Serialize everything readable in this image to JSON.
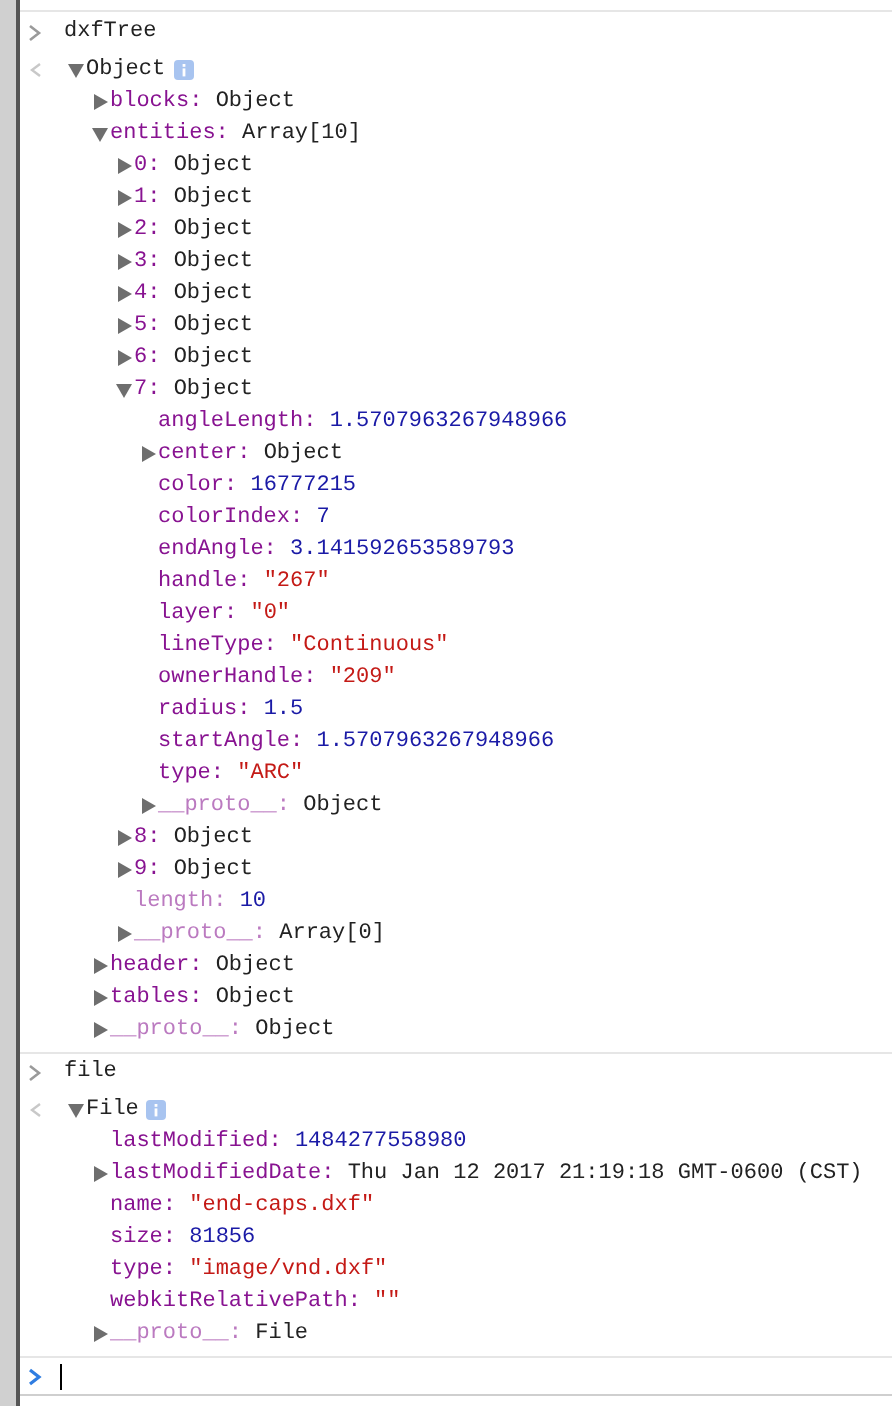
{
  "entries": [
    {
      "kind": "command",
      "text": "dxfTree"
    },
    {
      "kind": "result",
      "tree": {
        "value": "Object",
        "kind": "object",
        "expanded": true,
        "info": true,
        "children": [
          {
            "key": "blocks:",
            "value": "Object",
            "kind": "object",
            "dim": false,
            "expanded": false
          },
          {
            "key": "entities:",
            "value": "Array[10]",
            "kind": "object",
            "dim": false,
            "expanded": true,
            "children": [
              {
                "key": "0:",
                "value": "Object",
                "kind": "object",
                "dim": false,
                "expanded": false
              },
              {
                "key": "1:",
                "value": "Object",
                "kind": "object",
                "dim": false,
                "expanded": false
              },
              {
                "key": "2:",
                "value": "Object",
                "kind": "object",
                "dim": false,
                "expanded": false
              },
              {
                "key": "3:",
                "value": "Object",
                "kind": "object",
                "dim": false,
                "expanded": false
              },
              {
                "key": "4:",
                "value": "Object",
                "kind": "object",
                "dim": false,
                "expanded": false
              },
              {
                "key": "5:",
                "value": "Object",
                "kind": "object",
                "dim": false,
                "expanded": false
              },
              {
                "key": "6:",
                "value": "Object",
                "kind": "object",
                "dim": false,
                "expanded": false
              },
              {
                "key": "7:",
                "value": "Object",
                "kind": "object",
                "dim": false,
                "expanded": true,
                "children": [
                  {
                    "key": "angleLength:",
                    "value": "1.5707963267948966",
                    "kind": "number",
                    "dim": false
                  },
                  {
                    "key": "center:",
                    "value": "Object",
                    "kind": "object",
                    "dim": false,
                    "expanded": false
                  },
                  {
                    "key": "color:",
                    "value": "16777215",
                    "kind": "number",
                    "dim": false
                  },
                  {
                    "key": "colorIndex:",
                    "value": "7",
                    "kind": "number",
                    "dim": false
                  },
                  {
                    "key": "endAngle:",
                    "value": "3.141592653589793",
                    "kind": "number",
                    "dim": false
                  },
                  {
                    "key": "handle:",
                    "value": "\"267\"",
                    "kind": "string",
                    "dim": false
                  },
                  {
                    "key": "layer:",
                    "value": "\"0\"",
                    "kind": "string",
                    "dim": false
                  },
                  {
                    "key": "lineType:",
                    "value": "\"Continuous\"",
                    "kind": "string",
                    "dim": false
                  },
                  {
                    "key": "ownerHandle:",
                    "value": "\"209\"",
                    "kind": "string",
                    "dim": false
                  },
                  {
                    "key": "radius:",
                    "value": "1.5",
                    "kind": "number",
                    "dim": false
                  },
                  {
                    "key": "startAngle:",
                    "value": "1.5707963267948966",
                    "kind": "number",
                    "dim": false
                  },
                  {
                    "key": "type:",
                    "value": "\"ARC\"",
                    "kind": "string",
                    "dim": false
                  },
                  {
                    "key": "__proto__:",
                    "value": "Object",
                    "kind": "object",
                    "dim": true,
                    "expanded": false
                  }
                ]
              },
              {
                "key": "8:",
                "value": "Object",
                "kind": "object",
                "dim": false,
                "expanded": false
              },
              {
                "key": "9:",
                "value": "Object",
                "kind": "object",
                "dim": false,
                "expanded": false
              },
              {
                "key": "length:",
                "value": "10",
                "kind": "number",
                "dim": true
              },
              {
                "key": "__proto__:",
                "value": "Array[0]",
                "kind": "object",
                "dim": true,
                "expanded": false
              }
            ]
          },
          {
            "key": "header:",
            "value": "Object",
            "kind": "object",
            "dim": false,
            "expanded": false
          },
          {
            "key": "tables:",
            "value": "Object",
            "kind": "object",
            "dim": false,
            "expanded": false
          },
          {
            "key": "__proto__:",
            "value": "Object",
            "kind": "object",
            "dim": true,
            "expanded": false
          }
        ]
      }
    },
    {
      "kind": "command",
      "text": "file"
    },
    {
      "kind": "result",
      "tree": {
        "value": "File",
        "kind": "object",
        "expanded": true,
        "info": true,
        "children": [
          {
            "key": "lastModified:",
            "value": "1484277558980",
            "kind": "number",
            "dim": false
          },
          {
            "key": "lastModifiedDate:",
            "value": "Thu Jan 12 2017 21:19:18 GMT-0600 (CST)",
            "kind": "object",
            "dim": false,
            "expanded": false
          },
          {
            "key": "name:",
            "value": "\"end-caps.dxf\"",
            "kind": "string",
            "dim": false
          },
          {
            "key": "size:",
            "value": "81856",
            "kind": "number",
            "dim": false
          },
          {
            "key": "type:",
            "value": "\"image/vnd.dxf\"",
            "kind": "string",
            "dim": false
          },
          {
            "key": "webkitRelativePath:",
            "value": "\"\"",
            "kind": "string",
            "dim": false
          },
          {
            "key": "__proto__:",
            "value": "File",
            "kind": "object",
            "dim": true,
            "expanded": false
          }
        ]
      }
    }
  ]
}
